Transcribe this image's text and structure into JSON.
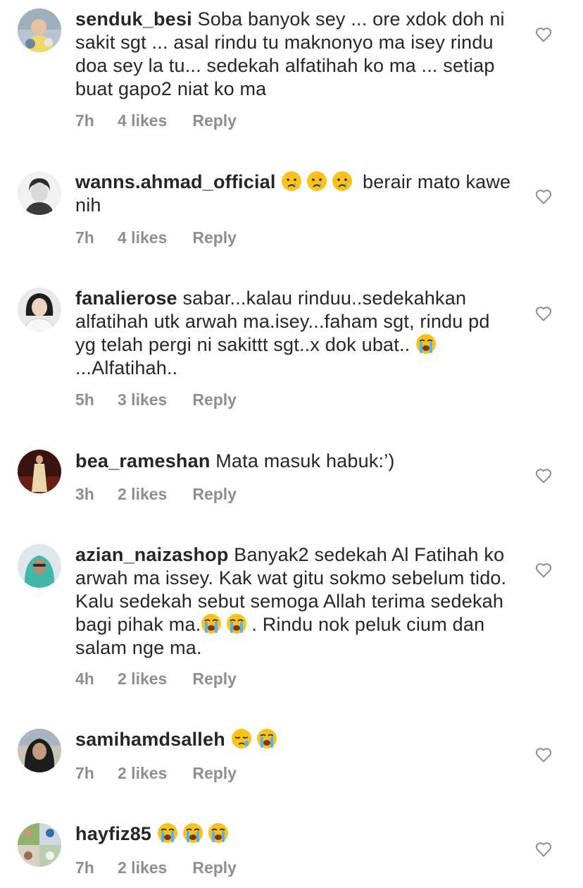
{
  "comments": [
    {
      "username": "senduk_besi",
      "text": "Soba banyok sey ... ore xdok doh ni sakit sgt ... asal rindu tu maknonyo ma isey rindu doa sey la tu... sedekah alfatihah ko ma ... setiap buat gapo2 niat ko ma",
      "time": "7h",
      "likes": "4 likes",
      "reply": "Reply"
    },
    {
      "username": "wanns.ahmad_official",
      "emojis": [
        "crying-face",
        "crying-face",
        "crying-face"
      ],
      "text": "berair mato kawe nih",
      "time": "7h",
      "likes": "4 likes",
      "reply": "Reply"
    },
    {
      "username": "fanalierose",
      "text": "sabar...kalau rinduu..sedekahkan alfatihah utk arwah ma.isey...faham sgt, rindu pd yg telah pergi ni sakittt sgt..x dok ubat..",
      "emojis": [
        "loudly-crying-face"
      ],
      "text_after": "...Alfatihah..",
      "time": "5h",
      "likes": "3 likes",
      "reply": "Reply"
    },
    {
      "username": "bea_rameshan",
      "text": "Mata masuk habuk:’)",
      "time": "3h",
      "likes": "2 likes",
      "reply": "Reply"
    },
    {
      "username": "azian_naizashop",
      "text": "Banyak2 sedekah Al Fatihah ko arwah ma issey. Kak wat gitu sokmo sebelum tido. Kalu sedekah sebut semoga Allah terima sedekah bagi pihak ma.",
      "emojis": [
        "loudly-crying-face",
        "loudly-crying-face"
      ],
      "text_after": ". Rindu nok peluk cium dan salam nge ma.",
      "time": "4h",
      "likes": "2 likes",
      "reply": "Reply"
    },
    {
      "username": "samihamdsalleh",
      "emojis": [
        "sleepy-face",
        "loudly-crying-face"
      ],
      "time": "7h",
      "likes": "2 likes",
      "reply": "Reply"
    },
    {
      "username": "hayfiz85",
      "emojis": [
        "loudly-crying-face",
        "loudly-crying-face",
        "loudly-crying-face"
      ],
      "time": "7h",
      "likes": "2 likes",
      "reply": "Reply"
    }
  ],
  "colors": {
    "text": "#262626",
    "meta": "#8e8e8e",
    "heart_outline": "#8e8e8e",
    "emoji_yellow": "#fcc21b",
    "tear_blue": "#4fb3f7"
  }
}
